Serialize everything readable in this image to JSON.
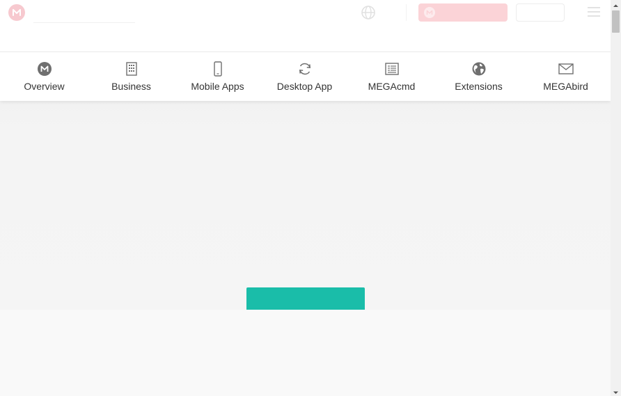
{
  "nav": {
    "items": [
      {
        "label": "Overview",
        "icon": "mega-logo-icon"
      },
      {
        "label": "Business",
        "icon": "building-icon"
      },
      {
        "label": "Mobile Apps",
        "icon": "mobile-phone-icon"
      },
      {
        "label": "Desktop App",
        "icon": "sync-icon"
      },
      {
        "label": "MEGAcmd",
        "icon": "terminal-list-icon"
      },
      {
        "label": "Extensions",
        "icon": "globe-icon"
      },
      {
        "label": "MEGAbird",
        "icon": "envelope-icon"
      }
    ]
  },
  "header": {
    "logo_icon": "mega-logo-icon",
    "language_icon": "globe-icon",
    "menu_icon": "hamburger-menu-icon"
  },
  "colors": {
    "brand_red": "#d90007",
    "accent_teal": "#1abda9",
    "icon_gray": "#777777"
  }
}
